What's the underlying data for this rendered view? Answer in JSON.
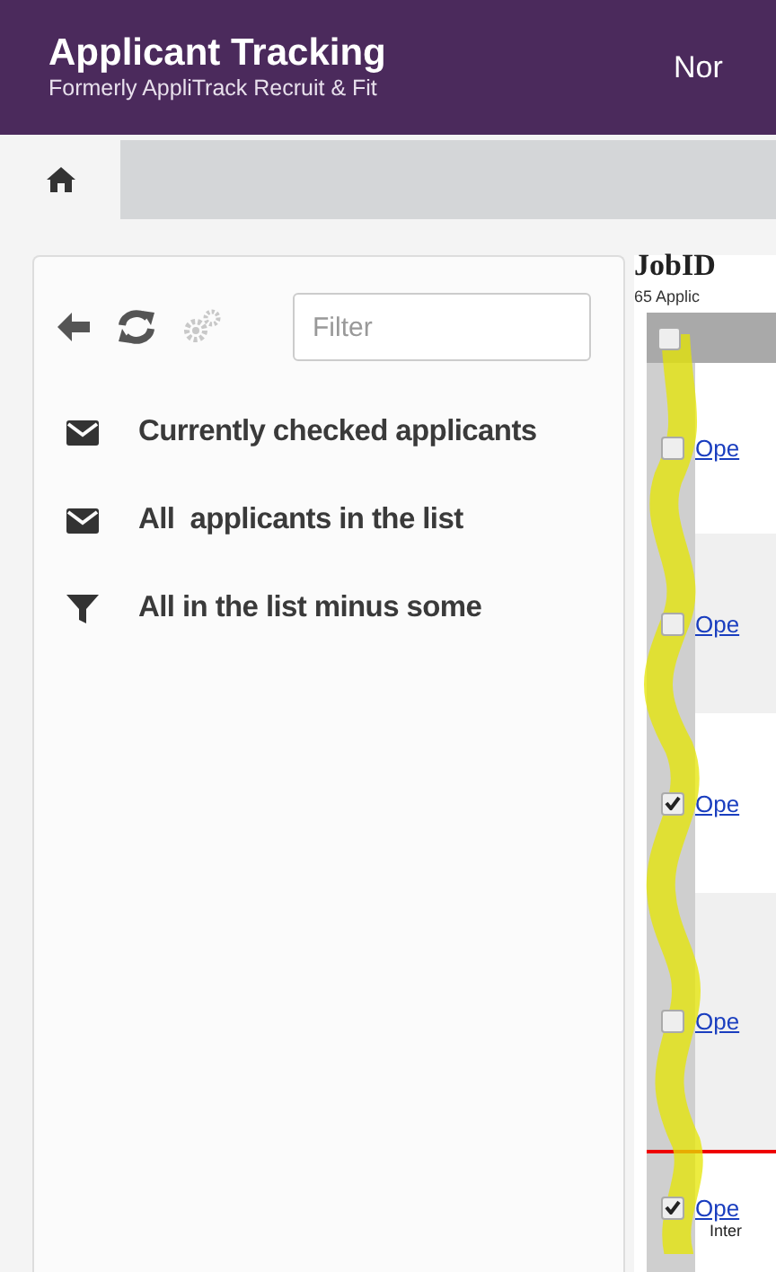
{
  "header": {
    "title": "Applicant Tracking",
    "subtitle": "Formerly AppliTrack Recruit & Fit",
    "right_text": "Nor"
  },
  "nav": {
    "home_selected": true
  },
  "panel": {
    "tools": [
      {
        "kind": "back",
        "disabled": false
      },
      {
        "kind": "refresh",
        "disabled": false
      },
      {
        "kind": "settings",
        "disabled": true
      }
    ],
    "filter": {
      "placeholder": "Filter"
    },
    "items": [
      {
        "kind": "mail",
        "label": "Currently checked applicants"
      },
      {
        "kind": "mail",
        "label": "All  applicants in the list"
      },
      {
        "kind": "filter",
        "label": "All in the list minus some"
      }
    ]
  },
  "results": {
    "title": "JobID",
    "count": "65 Applic",
    "header_checked": false,
    "rows": [
      {
        "link": "Ope",
        "checked": false
      },
      {
        "link": "Ope",
        "checked": false
      },
      {
        "link": "Ope",
        "checked": true
      },
      {
        "link": "Ope",
        "checked": false
      },
      {
        "link": "Ope",
        "checked": true,
        "note": "Inter"
      }
    ]
  }
}
